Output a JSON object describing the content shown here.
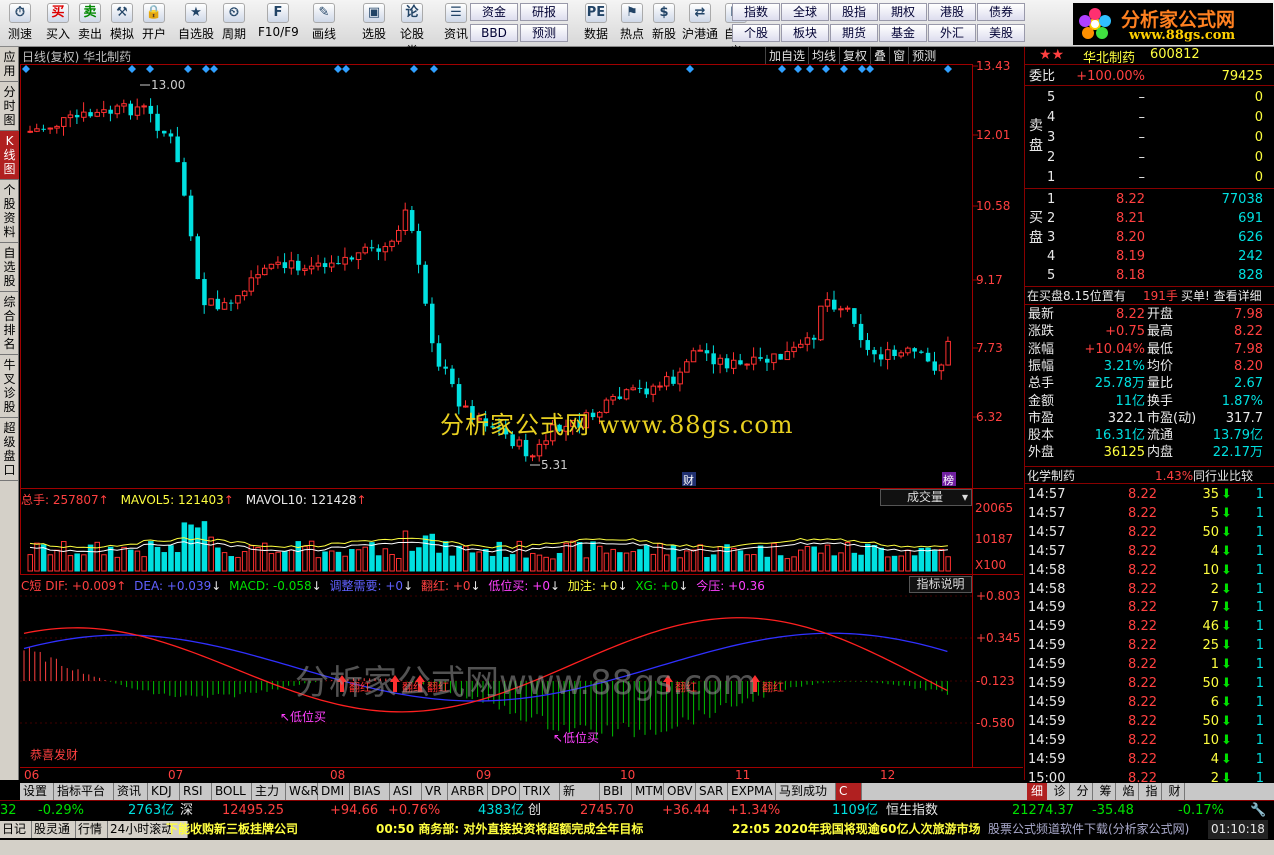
{
  "toolbar": {
    "items": [
      "测速",
      "买入",
      "卖出",
      "模拟",
      "开户",
      "自选股",
      "周期",
      "F10/F9",
      "画线",
      "选股",
      "论股堂",
      "资讯",
      "数据",
      "热点",
      "新股",
      "沪港通",
      "自定义"
    ],
    "btns_a": [
      "资金",
      "研报",
      "BBD",
      "预测"
    ],
    "btns_b": [
      "指数",
      "全球",
      "股指",
      "期权",
      "港股",
      "债券",
      "个股",
      "板块",
      "期货",
      "基金",
      "外汇",
      "美股"
    ]
  },
  "logo": {
    "line1": "分析家公式网",
    "line2": "www.88gs.com"
  },
  "leftnav": [
    {
      "label": "应用",
      "active": false
    },
    {
      "label": "分时图",
      "active": false
    },
    {
      "label": "K线图",
      "active": true
    },
    {
      "label": "个股资料",
      "active": false
    },
    {
      "label": "自选股",
      "active": false
    },
    {
      "label": "综合排名",
      "active": false
    },
    {
      "label": "牛叉诊股",
      "active": false
    },
    {
      "label": "超级盘口",
      "active": false
    }
  ],
  "chart_header": {
    "title": "日线(复权) 华北制药",
    "tools": [
      "加自选",
      "均线",
      "复权",
      "叠",
      "窗",
      "预测"
    ]
  },
  "price_axis": [
    "13.43",
    "12.01",
    "10.58",
    "9.17",
    "7.73",
    "6.32"
  ],
  "price_marks": {
    "high": "13.00",
    "low": "5.31",
    "cai": "财",
    "bang": "榜"
  },
  "watermark1": "分析家公式网 www.88gs.com",
  "watermark2": "分析家公式网www.88gs.com",
  "volume": {
    "label": "总手: 257807",
    "ma5": "MAVOL5: 121403",
    "ma10": "MAVOL10: 121428",
    "selector": "成交量",
    "axis": [
      "20065",
      "10187",
      "X100"
    ]
  },
  "macd": {
    "name": "C短",
    "dif": "DIF: +0.009",
    "dea": "DEA: +0.039",
    "macd": "MACD: -0.058",
    "adj": "调整需要: +0",
    "fh": "翻红: +0",
    "dwm": "低位买: +0",
    "jz": "加注: +0",
    "xg": "XG: +0",
    "jy": "今压: +0.36",
    "explain": "指标说明",
    "axis": [
      "+0.803",
      "+0.345",
      "-0.123",
      "-0.580"
    ],
    "annot_low": "低位买",
    "annot_red": "翻红",
    "bottom": "恭喜发财"
  },
  "dates": [
    "06",
    "07",
    "08",
    "09",
    "10",
    "11",
    "12"
  ],
  "stock": {
    "name": "华北制药",
    "code": "600812"
  },
  "orderbook": {
    "weibi": "委比",
    "weibi_pct": "+100.00%",
    "weibi_val": "79425",
    "sell_label": "卖盘",
    "buy_label": "买盘",
    "sells": [
      {
        "n": "5",
        "p": "–",
        "v": "0"
      },
      {
        "n": "4",
        "p": "–",
        "v": "0"
      },
      {
        "n": "3",
        "p": "–",
        "v": "0"
      },
      {
        "n": "2",
        "p": "–",
        "v": "0"
      },
      {
        "n": "1",
        "p": "–",
        "v": "0"
      }
    ],
    "buys": [
      {
        "n": "1",
        "p": "8.22",
        "v": "77038"
      },
      {
        "n": "2",
        "p": "8.21",
        "v": "691"
      },
      {
        "n": "3",
        "p": "8.20",
        "v": "626"
      },
      {
        "n": "4",
        "p": "8.19",
        "v": "242"
      },
      {
        "n": "5",
        "p": "8.18",
        "v": "828"
      }
    ],
    "note": "在买盘8.15位置有",
    "note2": "191手",
    "note3": "买单! 查看详细"
  },
  "quote": [
    [
      "最新",
      "8.22",
      "开盘",
      "7.98"
    ],
    [
      "涨跌",
      "+0.75",
      "最高",
      "8.22"
    ],
    [
      "涨幅",
      "+10.04%",
      "最低",
      "7.98"
    ],
    [
      "振幅",
      "3.21%",
      "均价",
      "8.20"
    ],
    [
      "总手",
      "25.78万",
      "量比",
      "2.67"
    ],
    [
      "金额",
      "11亿",
      "换手",
      "1.87%"
    ],
    [
      "市盈",
      "322.1",
      "市盈(动)",
      "317.7"
    ],
    [
      "股本",
      "16.31亿",
      "流通",
      "13.79亿"
    ],
    [
      "外盘",
      "36125",
      "内盘",
      "22.17万"
    ]
  ],
  "industry": {
    "name": "化学制药",
    "pct": "1.43%",
    "compare": "同行业比较"
  },
  "ticks": [
    [
      "14:57",
      "8.22",
      "35",
      "1"
    ],
    [
      "14:57",
      "8.22",
      "5",
      "1"
    ],
    [
      "14:57",
      "8.22",
      "50",
      "1"
    ],
    [
      "14:57",
      "8.22",
      "4",
      "1"
    ],
    [
      "14:58",
      "8.22",
      "10",
      "1"
    ],
    [
      "14:58",
      "8.22",
      "2",
      "1"
    ],
    [
      "14:59",
      "8.22",
      "7",
      "1"
    ],
    [
      "14:59",
      "8.22",
      "46",
      "1"
    ],
    [
      "14:59",
      "8.22",
      "25",
      "1"
    ],
    [
      "14:59",
      "8.22",
      "1",
      "1"
    ],
    [
      "14:59",
      "8.22",
      "50",
      "1"
    ],
    [
      "14:59",
      "8.22",
      "6",
      "1"
    ],
    [
      "14:59",
      "8.22",
      "50",
      "1"
    ],
    [
      "14:59",
      "8.22",
      "10",
      "1"
    ],
    [
      "14:59",
      "8.22",
      "4",
      "1"
    ],
    [
      "15:00",
      "8.22",
      "2",
      "1"
    ]
  ],
  "rtabs": [
    "细",
    "诊",
    "分",
    "筹",
    "焰",
    "指",
    "财"
  ],
  "bottomtabs": [
    "设置",
    "指标平台",
    "资讯",
    "KDJ",
    "RSI",
    "BOLL",
    "主力",
    "W&R",
    "DMI",
    "BIAS",
    "ASI",
    "VR",
    "ARBR",
    "DPO",
    "TRIX",
    "新DMA",
    "BBI",
    "MTM",
    "OBV",
    "SAR",
    "EXPMA",
    "马到成功",
    "C短"
  ],
  "ticker": [
    {
      "t": "32",
      "c": "green"
    },
    {
      "t": "-0.29%",
      "c": "green"
    },
    {
      "t": "2763亿",
      "c": "cyan"
    },
    {
      "t": "深",
      "c": "white"
    },
    {
      "t": "12495.25",
      "c": "red"
    },
    {
      "t": "+94.66",
      "c": "red"
    },
    {
      "t": "+0.76%",
      "c": "red"
    },
    {
      "t": "4383亿",
      "c": "cyan"
    },
    {
      "t": "创",
      "c": "white"
    },
    {
      "t": "2745.70",
      "c": "red"
    },
    {
      "t": "+36.44",
      "c": "red"
    },
    {
      "t": "+1.34%",
      "c": "red"
    },
    {
      "t": "1109亿",
      "c": "cyan"
    },
    {
      "t": "恒生指数",
      "c": "white"
    },
    {
      "t": "21274.37",
      "c": "green"
    },
    {
      "t": "-35.48",
      "c": "green"
    },
    {
      "t": "-0.17%",
      "c": "green"
    }
  ],
  "news": {
    "tabs": [
      "日记",
      "股灵通",
      "行情",
      "24小时滚动"
    ],
    "items": [
      "下能收购新三板挂牌公司",
      "00:50 商务部: 对外直接投资将超额完成全年目标",
      "22:05 2020年我国将现逾60亿人次旅游市场"
    ],
    "right": "股票公式频道软件下载(分析家公式网)",
    "time": "01:10:18"
  }
}
